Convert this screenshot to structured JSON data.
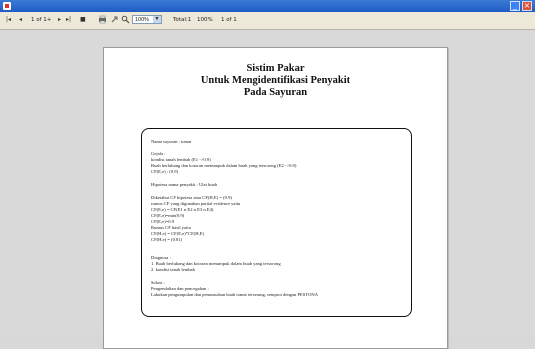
{
  "toolbar": {
    "first_icon": "|◂",
    "prev_icon": "◂",
    "page_box": "1 of 1+",
    "next_icon": "▸",
    "last_icon": "▸|",
    "stop_icon": "■",
    "print_icon": "printer-icon",
    "export_icon": "export-icon",
    "search_icon": "search-icon",
    "zoom": "100%",
    "total_label": "Total:1",
    "pct_label": "100%",
    "of_label": "1 of 1"
  },
  "report": {
    "title_1": "Sistim Pakar",
    "title_2": "Untuk Mengidentifikasi Penyakit",
    "title_3": "Pada Sayuran",
    "lines": [
      "Nama sayuran : tomat",
      "Gejala :",
      " kondisi tanah lembab  (E1 ->0.9)",
      " Buah berlubang dan kotoran menumpuk dalam buah yang tersorong  (E2 ->0.8)",
      "CF(E,e) : (0.9)",
      "Hipotesa nama penyakit : Ulat buah",
      "Diketahui CF hipotesa atau CF(H,E) = (0.9)",
      "rumus CF yang digunakan partial evidence yaitu",
      "CF(E,e) = CF(E1 n E2 n E3 n E4)",
      "CF(E,e)=min(0.9)",
      "CF(E,e)=0.9",
      "Rumus CF hasil yaitu",
      "CF(H,e) = CF(E,e)*CF(H,E)",
      "CF(H,e) = (0.81)",
      "Diagnosa :",
      "1. Buah berlubang dan kotoran menumpuk dalam buah yang tersorong",
      "2. kondisi tanah lembab",
      "Solusi :",
      "Pengendalian dan pencegahan :",
      "Lakukan pengumpulan dan pemusnahan buah tomat terserang, semprot dengan PESTONA"
    ]
  }
}
